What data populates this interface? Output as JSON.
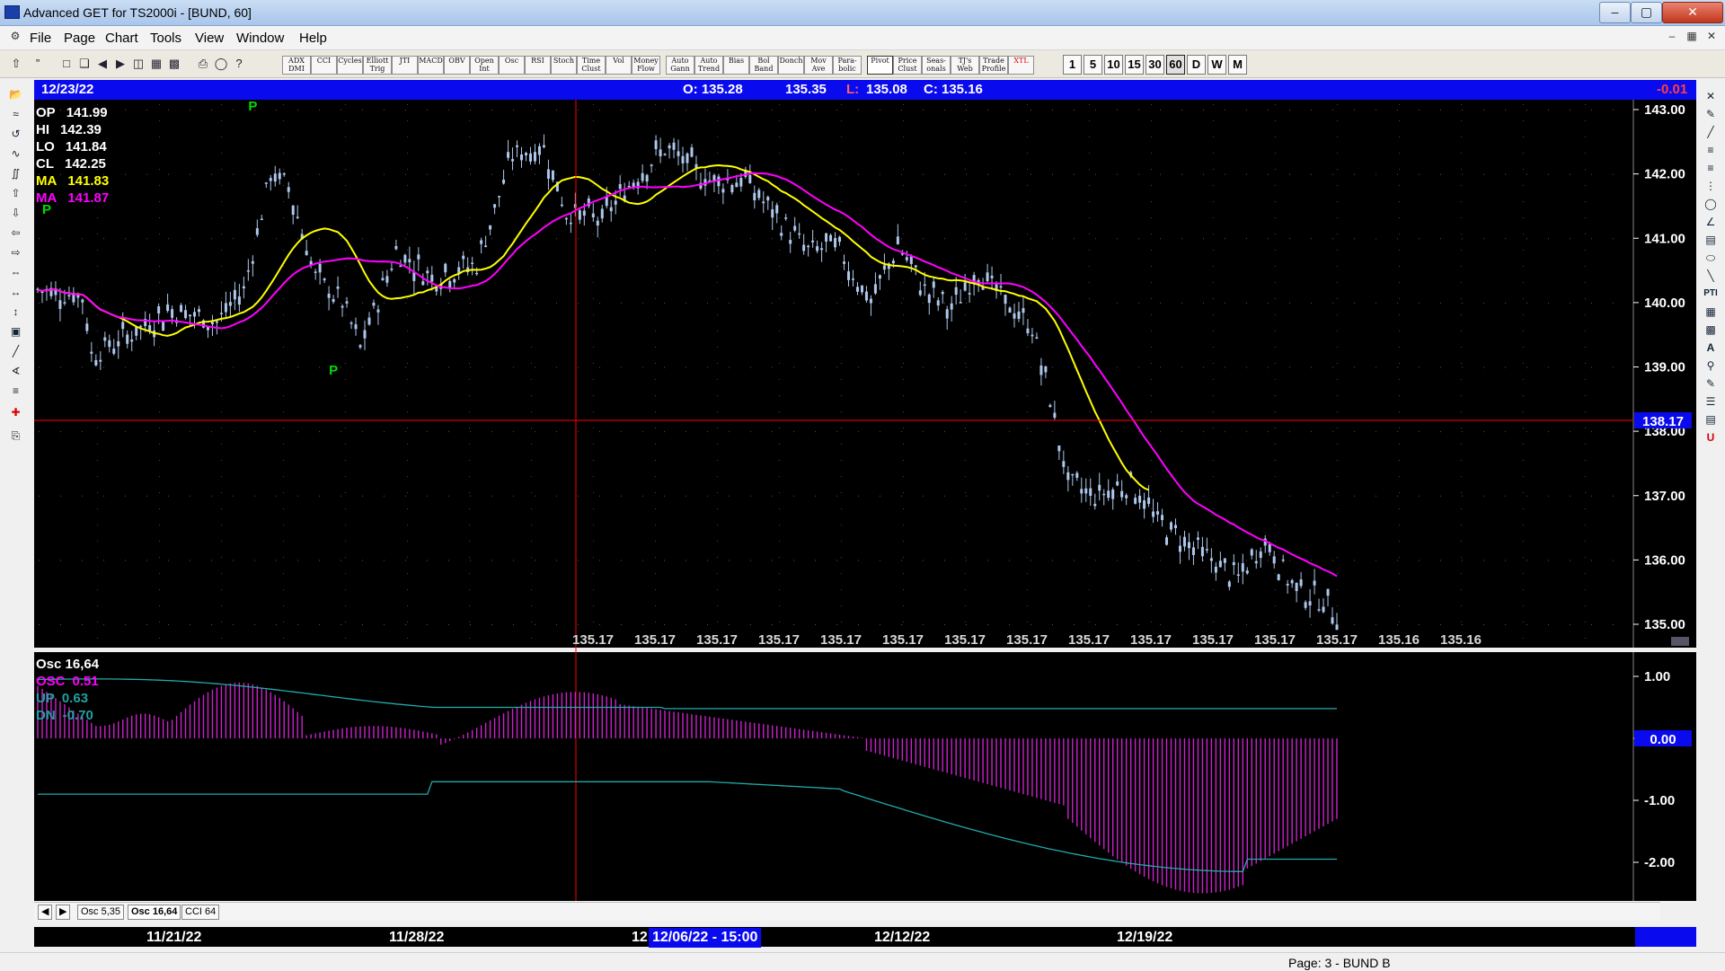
{
  "window": {
    "title": "Advanced GET for TS2000i - [BUND, 60]"
  },
  "menu": [
    "File",
    "Page",
    "Chart",
    "Tools",
    "View",
    "Window",
    "Help"
  ],
  "toolbar": {
    "studies": [
      "ADX DMI",
      "CCI",
      "Cycles",
      "Elliott Trig",
      "JTI",
      "MACD",
      "OBV",
      "Open Int",
      "Osc",
      "RSI",
      "Stoch",
      "Time Clust",
      "Vol",
      "Money Flow",
      "Auto Gann",
      "Auto Trend",
      "Bias",
      "Bol Band",
      "Donch",
      "Mov Ave",
      "Para- bolic",
      "Pivot",
      "Price Clust",
      "Seas- onals",
      "TJ's Web",
      "Trade Profile",
      "XTL"
    ],
    "timeframes": [
      "1",
      "5",
      "10",
      "15",
      "30",
      "60",
      "D",
      "W",
      "M"
    ],
    "left_icons": [
      "pointer-icon",
      "double-quote-icon"
    ]
  },
  "infobar": {
    "date": "12/23/22",
    "open": "O: 135.28",
    "high": "135.35",
    "low_label": "L:",
    "low": "135.08",
    "close": "C: 135.16",
    "change": "-0.01"
  },
  "price_indicators": [
    {
      "label": "OP",
      "value": "141.99",
      "color": "#ffffff"
    },
    {
      "label": "HI",
      "value": "142.39",
      "color": "#ffffff"
    },
    {
      "label": "LO",
      "value": "141.84",
      "color": "#ffffff"
    },
    {
      "label": "CL",
      "value": "142.25",
      "color": "#ffffff"
    },
    {
      "label": "MA",
      "value": "141.83",
      "color": "#ffff00"
    },
    {
      "label": "MA",
      "value": "141.87",
      "color": "#ff00ff"
    }
  ],
  "osc_indicators": {
    "title": "Osc 16,64",
    "items": [
      {
        "label": "OSC",
        "value": "0.51",
        "color": "#ff00ff"
      },
      {
        "label": "UP",
        "value": "0.63",
        "color": "#20a0a0"
      },
      {
        "label": "DN",
        "value": "-0.70",
        "color": "#20a0a0"
      }
    ]
  },
  "price_axis": {
    "ticks": [
      "143.00",
      "142.00",
      "141.00",
      "140.00",
      "139.00",
      "138.00",
      "137.00",
      "136.00",
      "135.00"
    ],
    "cursor_label": "138.17",
    "x_label_values": [
      "135.17",
      "135.17",
      "135.17",
      "135.17",
      "135.17",
      "135.17",
      "135.17",
      "135.17",
      "135.17",
      "135.17",
      "135.17",
      "135.17",
      "135.17",
      "135.16",
      "135.16"
    ]
  },
  "osc_axis": {
    "ticks": [
      "1.00",
      "0.00",
      "-1.00",
      "-2.00"
    ],
    "zero_label": "0.00"
  },
  "pivot_label": "P",
  "tabs": [
    "Osc 5,35",
    "Osc 16,64",
    "CCI 64"
  ],
  "dates": [
    "11/21/22",
    "11/28/22",
    "12",
    "12/12/22",
    "12/19/22"
  ],
  "date_cursor": "12/06/22 - 15:00",
  "status": "Page: 3 - BUND B",
  "colors": {
    "ma_fast": "#ffff00",
    "ma_slow": "#ff00ff",
    "bars": "#aec8ec",
    "osc": "#cc22cc",
    "band": "#22aaaa",
    "cursor": "#ff0000",
    "pivot": "#00dd00",
    "infobar": "#0a0aef"
  },
  "chart_data": [
    {
      "type": "candlestick",
      "title": "BUND, 60",
      "ylim": [
        134.6,
        143.0
      ],
      "x": [
        "11/21/22",
        "11/28/22",
        "12/06/22",
        "12/12/22",
        "12/19/22",
        "12/23/22"
      ],
      "close": [
        140.2,
        140.3,
        141.9,
        140.5,
        137.0,
        135.16
      ],
      "ma_fast_last": 141.83,
      "ma_slow_last": 141.87
    },
    {
      "type": "bar",
      "title": "Osc 16,64",
      "ylim": [
        -2.5,
        1.3
      ],
      "osc_last": 0.51,
      "up": 0.63,
      "dn": -0.7
    }
  ]
}
